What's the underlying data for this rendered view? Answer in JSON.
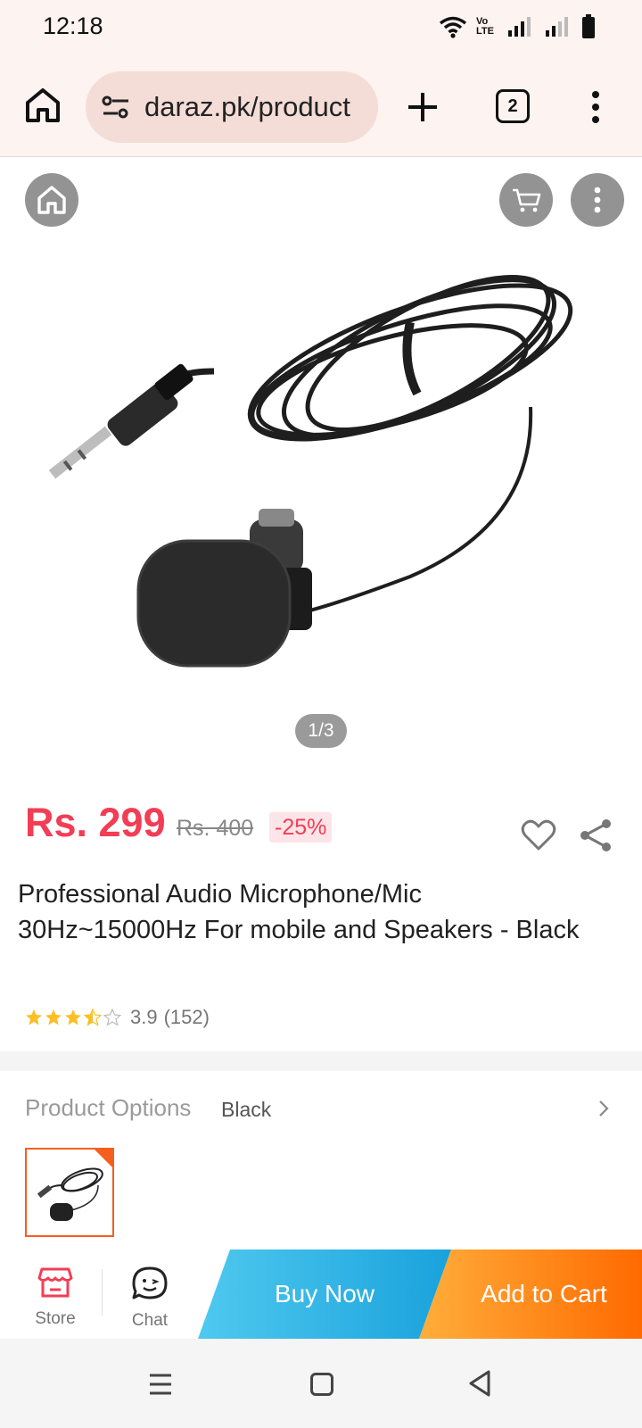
{
  "status_bar": {
    "time": "12:18",
    "volte_label": "Vo LTE",
    "icons": [
      "wifi-icon",
      "volte-icon",
      "signal-icon",
      "signal-icon",
      "battery-icon"
    ]
  },
  "browser": {
    "url": "daraz.pk/product",
    "tab_count": "2",
    "icons": [
      "home-icon",
      "site-settings-icon",
      "plus-icon",
      "tabs-icon",
      "more-vert-icon"
    ]
  },
  "gallery": {
    "counter": "1/3",
    "icons": [
      "home-icon",
      "cart-icon",
      "more-vert-icon"
    ]
  },
  "product": {
    "price": "Rs. 299",
    "old_price": "Rs. 400",
    "discount": "-25%",
    "title": "Professional Audio Microphone/Mic 30Hz~15000Hz For mobile and Speakers - Black",
    "rating_value": "3.9",
    "rating_count": "(152)",
    "rating_stars": 3.5,
    "accent_color": "#f23d55"
  },
  "options": {
    "label": "Product Options",
    "value": "Black"
  },
  "actions": {
    "store": "Store",
    "chat": "Chat",
    "buy_now": "Buy Now",
    "add_to_cart": "Add to Cart",
    "buy_color": "#1aa2dc",
    "cart_color": "#ff6a00"
  },
  "nav": {
    "icons": [
      "recent-apps-icon",
      "home-circle-icon",
      "back-icon"
    ]
  }
}
